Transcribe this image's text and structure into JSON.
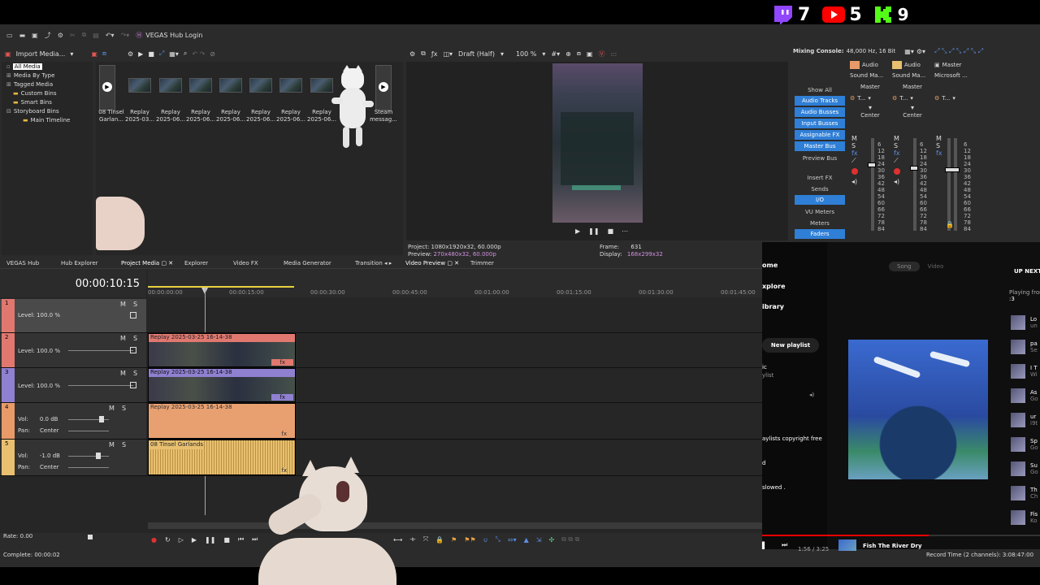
{
  "stream_overlay": {
    "twitch_count": "7",
    "youtube_count": "5",
    "kick_count": "9"
  },
  "app": {
    "title": "VEGAS Hub Login"
  },
  "media_panel": {
    "import_label": "Import Media...",
    "tree": [
      "All Media",
      "Media By Type",
      "Tagged Media",
      "Custom Bins",
      "Smart Bins",
      "Storyboard Bins",
      "Main Timeline"
    ],
    "thumbs": [
      {
        "l1": "08 Tinsel",
        "l2": "Garlan..."
      },
      {
        "l1": "Replay",
        "l2": "2025-03..."
      },
      {
        "l1": "Replay",
        "l2": "2025-06..."
      },
      {
        "l1": "Replay",
        "l2": "2025-06..."
      },
      {
        "l1": "Replay",
        "l2": "2025-06..."
      },
      {
        "l1": "Replay",
        "l2": "2025-06..."
      },
      {
        "l1": "Replay",
        "l2": "2025-06..."
      },
      {
        "l1": "Replay",
        "l2": "2025-06..."
      },
      {
        "l1": "Steam",
        "l2": "messag..."
      }
    ]
  },
  "preview": {
    "quality": "Draft (Half)",
    "zoom": "100 %",
    "project_label": "Project:",
    "project_value": "1080x1920x32, 60.000p",
    "preview_label": "Preview:",
    "preview_value": "270x480x32, 60.000p",
    "frame_label": "Frame:",
    "frame_value": "631",
    "display_label": "Display:",
    "display_value": "168x299x32"
  },
  "mixer": {
    "title": "Mixing Console:",
    "info": "48,000 Hz, 16 Bit",
    "buttons": [
      {
        "label": "Show All",
        "active": false
      },
      {
        "label": "Audio Tracks",
        "active": true
      },
      {
        "label": "Audio Busses",
        "active": true
      },
      {
        "label": "Input Busses",
        "active": true
      },
      {
        "label": "Assignable FX",
        "active": true
      },
      {
        "label": "Master Bus",
        "active": true
      },
      {
        "label": "Preview Bus",
        "active": false
      },
      {
        "label": "Insert FX",
        "active": false
      },
      {
        "label": "Sends",
        "active": false
      },
      {
        "label": "I/O",
        "active": true
      },
      {
        "label": "VU Meters",
        "active": false
      },
      {
        "label": "Meters",
        "active": false
      },
      {
        "label": "Faders",
        "active": true
      }
    ],
    "channels": [
      {
        "name": "Audio",
        "line1": "Sound Ma...",
        "line2": "Master",
        "fx": "T...",
        "pan": "Center",
        "color": "#e89a68"
      },
      {
        "name": "Audio",
        "line1": "Sound Ma...",
        "line2": "Master",
        "fx": "T...",
        "pan": "Center",
        "color": "#e8c070"
      },
      {
        "name": "Master",
        "line1": "Microsoft ...",
        "line2": "",
        "fx": "T...",
        "pan": "",
        "color": "#bbb"
      }
    ],
    "scale": [
      "6",
      "12",
      "18",
      "24",
      "30",
      "36",
      "42",
      "48",
      "54",
      "60",
      "66",
      "72",
      "78",
      "84"
    ]
  },
  "tabs": [
    {
      "label": "VEGAS Hub"
    },
    {
      "label": "Hub Explorer"
    },
    {
      "label": "Project Media"
    },
    {
      "label": "Explorer"
    },
    {
      "label": "Video FX"
    },
    {
      "label": "Media Generator"
    },
    {
      "label": "Transition"
    },
    {
      "label": "Video Preview"
    },
    {
      "label": "Trimmer"
    }
  ],
  "timeline": {
    "timecode": "00:00:10:15",
    "ruler": [
      "00:00:00:00",
      "00:00:15:00",
      "00:00:30:00",
      "00:00:45:00",
      "00:01:00:00",
      "00:01:15:00",
      "00:01:30:00",
      "00:01:45:00"
    ],
    "tracks": [
      {
        "num": "1",
        "level": "Level: 100.0 %",
        "color": "#e07870",
        "type": "video"
      },
      {
        "num": "2",
        "level": "Level: 100.0 %",
        "color": "#e07870",
        "type": "video",
        "clip": "Replay 2025-03-25 16-14-38"
      },
      {
        "num": "3",
        "level": "Level: 100.0 %",
        "color": "#8f80d0",
        "type": "video",
        "clip": "Replay 2025-03-25 16-14-38"
      },
      {
        "num": "4",
        "vol": "Vol:",
        "vol_value": "0.0 dB",
        "pan": "Pan:",
        "pan_value": "Center",
        "color": "#e89a68",
        "type": "audio",
        "clip": "Replay 2025-03-25 16-14-38"
      },
      {
        "num": "5",
        "vol": "Vol:",
        "vol_value": "-1.0 dB",
        "pan": "Pan:",
        "pan_value": "Center",
        "color": "#e8c070",
        "type": "audio",
        "clip": "08 Tinsel Garlands"
      }
    ],
    "rate": "Rate: 0.00",
    "complete": "Complete: 00:00:02",
    "record_time": "Record Time (2 channels): 3:08:47:00"
  },
  "music_app": {
    "nav": [
      "ome",
      "xplore",
      "ibrary"
    ],
    "new_playlist": "New playlist",
    "side_items": [
      "ic",
      "ylist",
      "aylists copyright free",
      "d",
      "slowed ."
    ],
    "toggle": [
      "Song",
      "Video"
    ],
    "up_next": "UP NEXT",
    "playing_from": "Playing from",
    "playing_from_2": ":3",
    "queue": [
      {
        "t": "Lo",
        "s": "un"
      },
      {
        "t": "pa",
        "s": "Se"
      },
      {
        "t": "I T",
        "s": "Wi"
      },
      {
        "t": "As",
        "s": "Go"
      },
      {
        "t": "ur",
        "s": "i9t"
      },
      {
        "t": "Sp",
        "s": "Go"
      },
      {
        "t": "Su",
        "s": "Go"
      },
      {
        "t": "Th",
        "s": "Ch"
      },
      {
        "t": "Fis",
        "s": "Ko"
      }
    ],
    "now_playing": "Fish The River Dry",
    "time": "1:56 / 3:25"
  }
}
